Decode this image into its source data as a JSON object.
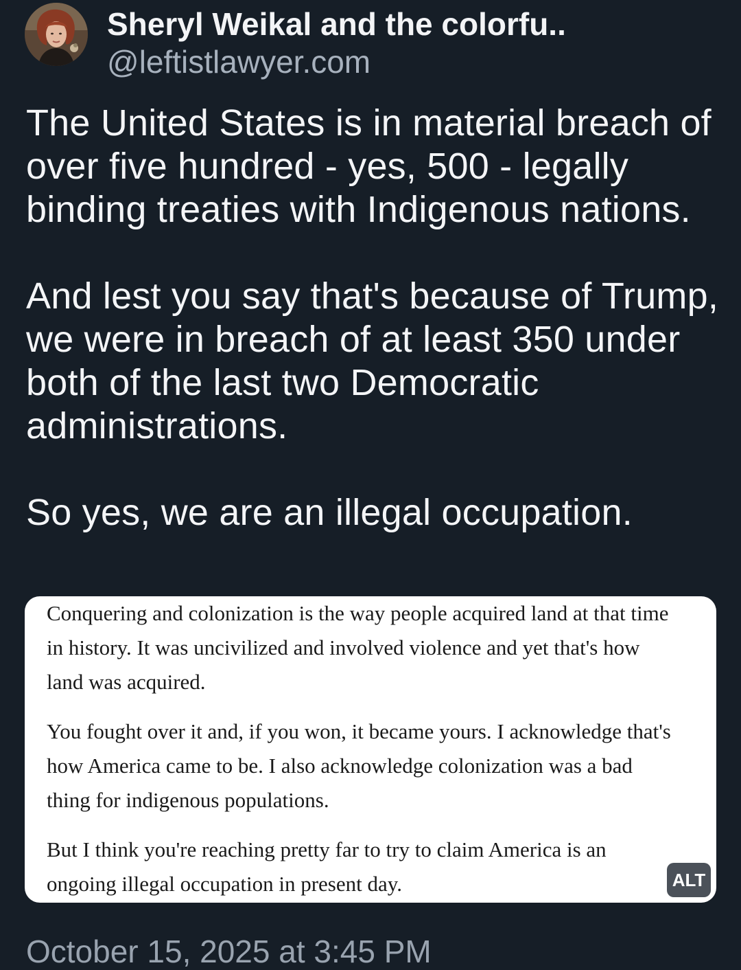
{
  "post": {
    "author": {
      "display_name": "Sheryl Weikal and the colorfu..",
      "handle": "@leftistlawyer.com",
      "avatar_icon": "profile-photo"
    },
    "paragraphs": [
      "The United States is in material breach of over five hundred - yes, 500 - legally binding treaties with Indigenous nations.",
      "And lest you say that's because of Trump, we were in breach of at least 350 under both of the last two Democratic administrations.",
      "So yes, we are an illegal occupation."
    ],
    "image": {
      "paragraphs": [
        "Conquering and colonization is the way people acquired land at that time in history. It was uncivilized and involved violence and yet that's how land was acquired.",
        "You fought over it and, if you won, it became yours. I acknowledge that's how America came to be. I also acknowledge colonization was a bad thing for indigenous populations.",
        "But I think you're reaching pretty far to try to claim America is an ongoing illegal occupation in present day."
      ],
      "alt_badge": "ALT"
    },
    "timestamp": "October 15, 2025 at 3:45 PM"
  },
  "colors": {
    "background": "#161e27",
    "text": "#f4f5f7",
    "muted_text": "#a7b1bd",
    "alt_badge_bg": "#4b5159"
  }
}
